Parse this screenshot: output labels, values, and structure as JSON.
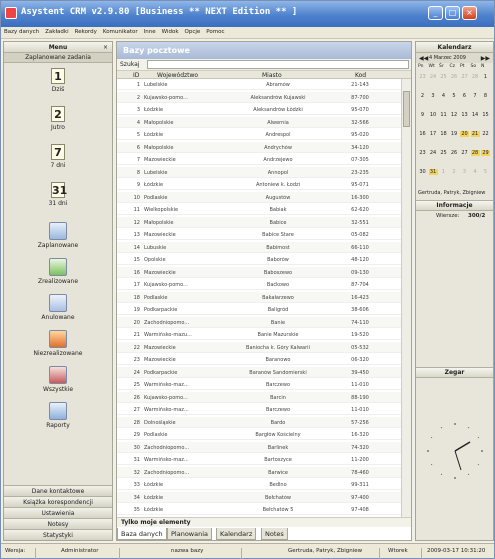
{
  "window": {
    "title": "Asystent CRM v2.9.80  [Business ** NEXT Edition ** ]",
    "controls": {
      "minimize": "_",
      "maximize": "□",
      "close": "×"
    }
  },
  "menubar": [
    "Bazy danych",
    "Zakładki",
    "Rekordy",
    "Komunikator",
    "Inne",
    "Widok",
    "Opcje",
    "Pomoc"
  ],
  "left_panel": {
    "header": "Menu",
    "close": "×",
    "section": "Zaplanowane zadania",
    "items": [
      {
        "num": "1",
        "label": "Dziś",
        "icon": "calendar-icon"
      },
      {
        "num": "2",
        "label": "Jutro",
        "icon": "calendar-icon"
      },
      {
        "num": "7",
        "label": "7 dni",
        "icon": "calendar-icon"
      },
      {
        "num": "31",
        "label": "31 dni",
        "icon": "calendar-icon"
      },
      {
        "label": "Zaplanowane",
        "icon": "planned-task-icon"
      },
      {
        "label": "Zrealizowane",
        "icon": "completed-task-icon"
      },
      {
        "label": "Anulowane",
        "icon": "cancelled-task-icon"
      },
      {
        "label": "Niezrealizowane",
        "icon": "failed-task-icon"
      },
      {
        "label": "Wszystkie",
        "icon": "all-tasks-icon"
      },
      {
        "label": "Raporty",
        "icon": "reports-icon"
      }
    ],
    "bottom_buttons": [
      "Dane kontaktowe",
      "Książka korespondencji",
      "Ustawienia",
      "Notesy",
      "Statystyki"
    ]
  },
  "center_panel": {
    "header": "Bazy pocztowe",
    "search_label": "Szukaj",
    "columns": [
      "ID",
      "Województwo",
      "Miasto",
      "Kod"
    ],
    "rows": [
      [
        "1",
        "Lubelskie",
        "Abramów",
        "21-143"
      ],
      [
        "2",
        "Kujawsko-pomo...",
        "Aleksandrów Kujawski",
        "87-700"
      ],
      [
        "3",
        "Łódzkie",
        "Aleksandrów Łódzki",
        "95-070"
      ],
      [
        "4",
        "Małopolskie",
        "Alwernia",
        "32-566"
      ],
      [
        "5",
        "Łódzkie",
        "Andrespol",
        "95-020"
      ],
      [
        "6",
        "Małopolskie",
        "Andrychów",
        "34-120"
      ],
      [
        "7",
        "Mazowieckie",
        "Andrzejewo",
        "07-305"
      ],
      [
        "8",
        "Lubelskie",
        "Annopol",
        "23-235"
      ],
      [
        "9",
        "Łódzkie",
        "Antoniew k. Łodzi",
        "95-071"
      ],
      [
        "10",
        "Podlaskie",
        "Augustów",
        "16-300"
      ],
      [
        "11",
        "Wielkopolskie",
        "Babiak",
        "62-620"
      ],
      [
        "12",
        "Małopolskie",
        "Babice",
        "32-551"
      ],
      [
        "13",
        "Mazowieckie",
        "Babice Stare",
        "05-082"
      ],
      [
        "14",
        "Lubuskie",
        "Babimost",
        "66-110"
      ],
      [
        "15",
        "Opolskie",
        "Baborów",
        "48-120"
      ],
      [
        "16",
        "Mazowieckie",
        "Baboszewo",
        "09-130"
      ],
      [
        "17",
        "Kujawsko-pomo...",
        "Baćkowo",
        "87-704"
      ],
      [
        "18",
        "Podlaskie",
        "Bakałarzewo",
        "16-423"
      ],
      [
        "19",
        "Podkarpackie",
        "Baligród",
        "38-606"
      ],
      [
        "20",
        "Zachodniopomo...",
        "Banie",
        "74-110"
      ],
      [
        "21",
        "Warmińsko-mazu...",
        "Banie Mazurskie",
        "19-520"
      ],
      [
        "22",
        "Mazowieckie",
        "Baniocha k. Góry Kalwarii",
        "05-532"
      ],
      [
        "23",
        "Mazowieckie",
        "Baranowo",
        "06-320"
      ],
      [
        "24",
        "Podkarpackie",
        "Baranów Sandomierski",
        "39-450"
      ],
      [
        "25",
        "Warmińsko-maz...",
        "Barczewo",
        "11-010"
      ],
      [
        "26",
        "Kujawsko-pomo...",
        "Barcin",
        "88-190"
      ],
      [
        "27",
        "Warmińsko-maz...",
        "Barczewo",
        "11-010"
      ],
      [
        "28",
        "Dolnośląskie",
        "Bardo",
        "57-256"
      ],
      [
        "29",
        "Podlaskie",
        "Bargłów Kościelny",
        "16-320"
      ],
      [
        "30",
        "Zachodniopomo...",
        "Barlinek",
        "74-320"
      ],
      [
        "31",
        "Warmińsko-maz...",
        "Bartoszyce",
        "11-200"
      ],
      [
        "32",
        "Zachodniopomo...",
        "Barwice",
        "78-460"
      ],
      [
        "33",
        "Łódzkie",
        "Bedlno",
        "99-311"
      ],
      [
        "34",
        "Łódzkie",
        "Bełchatów",
        "97-400"
      ],
      [
        "35",
        "Łódzkie",
        "Bełchatów 5",
        "97-408"
      ]
    ],
    "footer": "Tylko moje elementy",
    "tabs": [
      "Baza danych",
      "Planowania",
      "Kalendarz",
      "Notes"
    ],
    "active_tab": 0
  },
  "right_panel": {
    "calendar_header": "Kalendarz",
    "month": "4 Marzec 2009",
    "nav_prev": "◀◀",
    "nav_next": "▶▶",
    "dow": [
      "Pn",
      "Wt",
      "Śr",
      "Cz",
      "Pt",
      "So",
      "N"
    ],
    "weeks": [
      [
        "23",
        "24",
        "25",
        "26",
        "27",
        "28",
        "1"
      ],
      [
        "2",
        "3",
        "4",
        "5",
        "6",
        "7",
        "8"
      ],
      [
        "9",
        "10",
        "11",
        "12",
        "13",
        "14",
        "15"
      ],
      [
        "16",
        "17",
        "18",
        "19",
        "20",
        "21",
        "22"
      ],
      [
        "23",
        "24",
        "25",
        "26",
        "27",
        "28",
        "29"
      ],
      [
        "30",
        "31",
        "1",
        "2",
        "3",
        "4",
        "5"
      ]
    ],
    "persons": "Gertruda, Patryk, Zbigniew",
    "info_header": "Informacje",
    "info_key": "Wiersze:",
    "info_value": "300/2",
    "clock_header": "Zegar"
  },
  "statusbar": {
    "label1": "Wersja:",
    "user": "Administrator",
    "db": "nazwa bazy",
    "people": "Gertruda, Patryk, Zbigniew",
    "label2": "Wtorek",
    "datetime": "2009-03-17 10:31:20"
  },
  "colors": {
    "title_bar": "#4f82cc",
    "highlight_day": "#f2d35c",
    "panel": "#e6e4d8"
  }
}
